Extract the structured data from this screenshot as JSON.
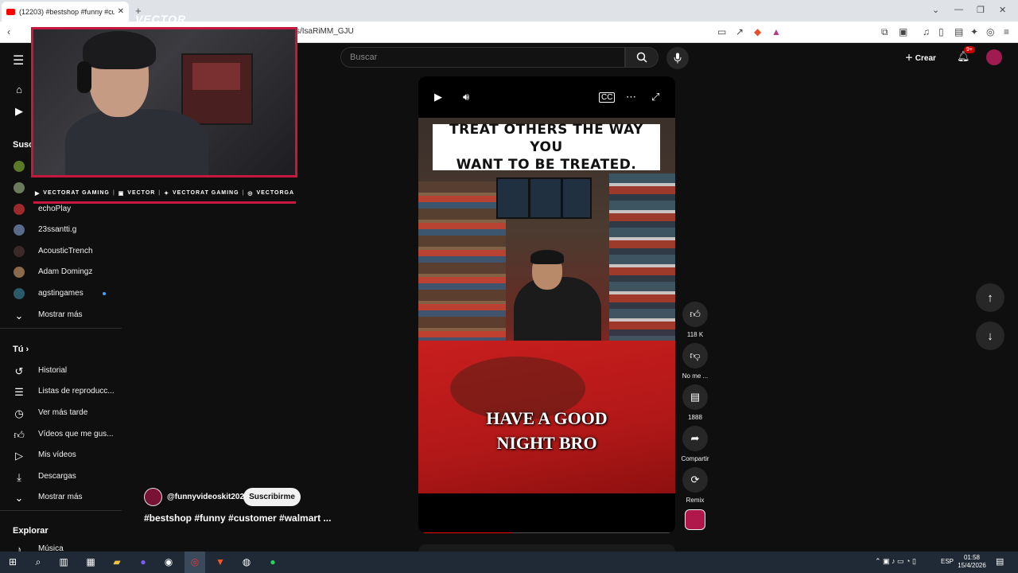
{
  "browser": {
    "tab_title": "(12203) #bestshop #funny #cus",
    "url": "s/IsaRiMM_GJU",
    "tab_close": "✕",
    "new_tab": "+"
  },
  "youtube": {
    "search_placeholder": "Buscar",
    "create_label": "Crear",
    "notifications_badge": "9+"
  },
  "sidebar": {
    "subscriptions_heading": "Susc",
    "channels": [
      {
        "name": "echoPlay",
        "color": "#9c2a2a"
      },
      {
        "name": "23ssantti.g",
        "color": "#5a6a8a"
      },
      {
        "name": "AcousticTrench",
        "color": "#3a2a2a"
      },
      {
        "name": "Adam Domingz",
        "color": "#8a6a4a"
      },
      {
        "name": "agstingames",
        "color": "#2a5a6a"
      }
    ],
    "show_more_1": "Mostrar más",
    "you_heading": "Tú",
    "you_items": [
      {
        "label": "Historial",
        "icon": "history-icon"
      },
      {
        "label": "Listas de reproducc...",
        "icon": "playlists-icon"
      },
      {
        "label": "Ver más tarde",
        "icon": "watch-later-icon"
      },
      {
        "label": "Vídeos que me gus...",
        "icon": "liked-videos-icon"
      },
      {
        "label": "Mis vídeos",
        "icon": "my-videos-icon"
      },
      {
        "label": "Descargas",
        "icon": "downloads-icon"
      }
    ],
    "show_more_2": "Mostrar más",
    "explore_heading": "Explorar",
    "explore_items": [
      {
        "label": "Música",
        "icon": "music-icon"
      }
    ]
  },
  "stream_overlay": {
    "name_tag": "VECTOR",
    "socials": [
      "VECTORAT GAMING",
      "VECTOR",
      "VECTORAT GAMING",
      "VECTORGA"
    ]
  },
  "video": {
    "top_caption": "TREAT OTHERS THE WAY YOU\nWANT TO BE TREATED.",
    "bottom_caption": "HAVE A GOOD\nNIGHT BRO",
    "progress_fraction": 0.36
  },
  "channel": {
    "handle": "@funnyvideoskit2025",
    "subscribe_label": "Suscribirme",
    "video_title": "#bestshop #funny #customer #walmart ..."
  },
  "actions": {
    "likes": "118 K",
    "dislike_label": "No me ...",
    "comments": "1888",
    "share_label": "Compartir",
    "remix_label": "Remix"
  },
  "taskbar": {
    "language": "ESP",
    "time": "01:58",
    "date": "15/4/2026"
  },
  "colors": {
    "accent_red": "#ff0000",
    "overlay_border": "#c7173f",
    "background": "#0f0f0f"
  }
}
